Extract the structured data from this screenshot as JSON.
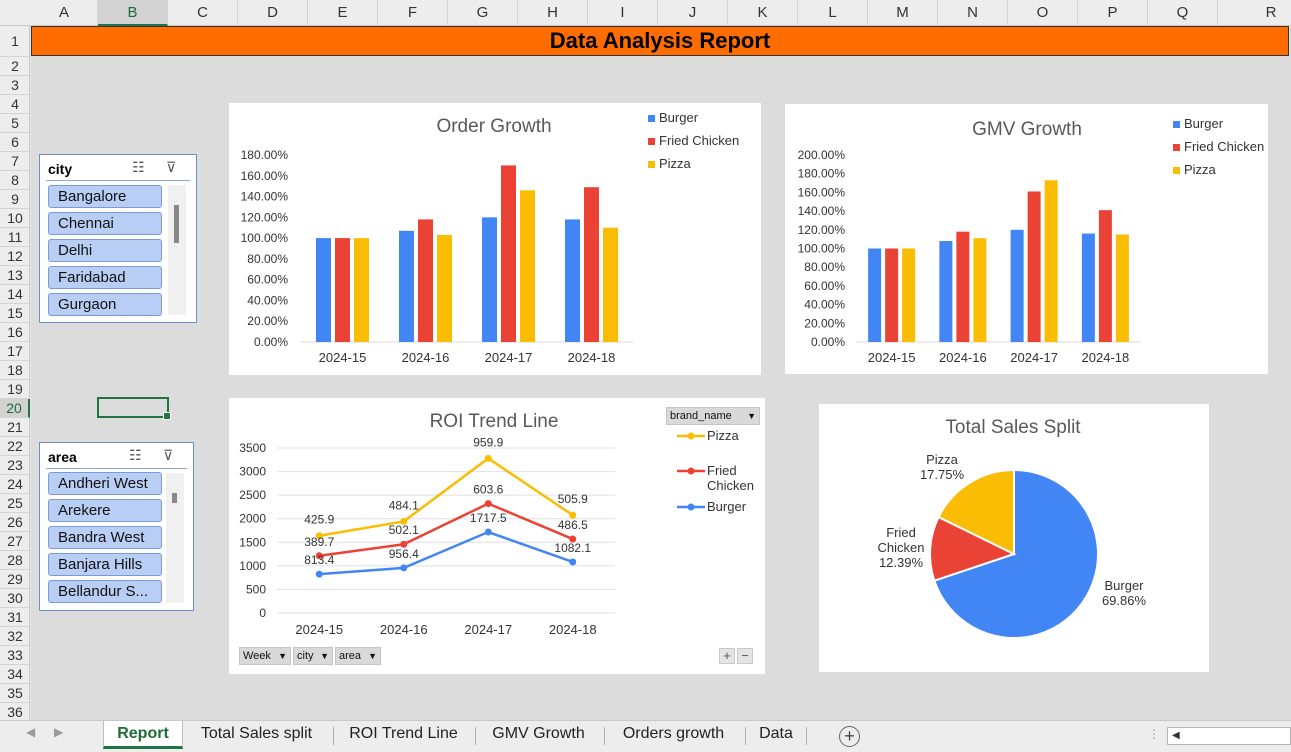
{
  "columns": [
    "A",
    "B",
    "C",
    "D",
    "E",
    "F",
    "G",
    "H",
    "I",
    "J",
    "K",
    "L",
    "M",
    "N",
    "O",
    "P",
    "Q",
    "R"
  ],
  "rows": [
    "1",
    "2",
    "3",
    "4",
    "5",
    "6",
    "7",
    "8",
    "9",
    "10",
    "11",
    "12",
    "13",
    "14",
    "15",
    "16",
    "17",
    "18",
    "19",
    "20",
    "21",
    "22",
    "23",
    "24",
    "25",
    "26",
    "27",
    "28",
    "29",
    "30",
    "31",
    "32",
    "33",
    "34",
    "35",
    "36"
  ],
  "selected_column": "B",
  "selected_row": "20",
  "title": "Data Analysis Report",
  "colors": {
    "burger": "#4285f4",
    "fried_chicken": "#ea4335",
    "pizza": "#fbbc04",
    "title_bg": "#ff6d00",
    "accent": "#217346"
  },
  "slicers": {
    "city": {
      "title": "city",
      "items": [
        "Bangalore",
        "Chennai",
        "Delhi",
        "Faridabad",
        "Gurgaon"
      ],
      "icons": [
        "multi-select-icon",
        "clear-filter-icon"
      ]
    },
    "area": {
      "title": "area",
      "items": [
        "Andheri West",
        "Arekere",
        "Bandra West",
        "Banjara Hills",
        "Bellandur S..."
      ],
      "icons": [
        "multi-select-icon",
        "clear-filter-icon"
      ]
    }
  },
  "pivot": {
    "legend_field": "brand_name",
    "filters": [
      "Week",
      "city",
      "area"
    ],
    "zoom_in": "+",
    "zoom_out": "−"
  },
  "tabs": {
    "items": [
      "Report",
      "Total Sales split",
      "ROI Trend Line",
      "GMV Growth",
      "Orders growth",
      "Data"
    ],
    "active": "Report"
  },
  "chart_data": [
    {
      "type": "bar",
      "title": "Order Growth",
      "categories": [
        "2024-15",
        "2024-16",
        "2024-17",
        "2024-18"
      ],
      "series": [
        {
          "name": "Burger",
          "values": [
            100,
            107,
            120,
            118
          ]
        },
        {
          "name": "Fried Chicken",
          "values": [
            100,
            118,
            170,
            149
          ]
        },
        {
          "name": "Pizza",
          "values": [
            100,
            103,
            146,
            110
          ]
        }
      ],
      "ylim": [
        0,
        180
      ],
      "yticks": [
        "0.00%",
        "20.00%",
        "40.00%",
        "60.00%",
        "80.00%",
        "100.00%",
        "120.00%",
        "140.00%",
        "160.00%",
        "180.00%"
      ],
      "legend": "top-right",
      "grid": false
    },
    {
      "type": "bar",
      "title": "GMV Growth",
      "categories": [
        "2024-15",
        "2024-16",
        "2024-17",
        "2024-18"
      ],
      "series": [
        {
          "name": "Burger",
          "values": [
            100,
            108,
            120,
            116
          ]
        },
        {
          "name": "Fried Chicken",
          "values": [
            100,
            118,
            161,
            141
          ]
        },
        {
          "name": "Pizza",
          "values": [
            100,
            111,
            173,
            115
          ]
        }
      ],
      "ylim": [
        0,
        200
      ],
      "yticks": [
        "0.00%",
        "20.00%",
        "40.00%",
        "60.00%",
        "80.00%",
        "100.00%",
        "120.00%",
        "140.00%",
        "160.00%",
        "180.00%",
        "200.00%"
      ],
      "legend": "top-right",
      "grid": false
    },
    {
      "type": "line",
      "title": "ROI Trend Line",
      "x": [
        "2024-15",
        "2024-16",
        "2024-17",
        "2024-18"
      ],
      "series": [
        {
          "name": "Pizza",
          "values": [
            1639.4,
            1942.6,
            3281,
            2074.5
          ],
          "labels": [
            "425.9",
            "484.1",
            "959.9",
            "505.9"
          ]
        },
        {
          "name": "Fried Chicken",
          "values": [
            1213.5,
            1458.5,
            2321.1,
            1568.6
          ],
          "labels": [
            "389.7",
            "502.1",
            "603.6",
            "486.5"
          ]
        },
        {
          "name": "Burger",
          "values": [
            823.8,
            956.4,
            1717.5,
            1082.1
          ],
          "labels": [
            "813.4",
            "956.4",
            "1717.5",
            "1082.1"
          ]
        }
      ],
      "ylim": [
        0,
        3500
      ],
      "yticks": [
        "0",
        "500",
        "1000",
        "1500",
        "2000",
        "2500",
        "3000",
        "3500"
      ],
      "legend": "right",
      "grid": true
    },
    {
      "type": "pie",
      "title": "Total Sales Split",
      "slices": [
        {
          "name": "Burger",
          "value": 69.86,
          "label": "69.86%"
        },
        {
          "name": "Fried Chicken",
          "value": 12.39,
          "label": "12.39%"
        },
        {
          "name": "Pizza",
          "value": 17.75,
          "label": "17.75%"
        }
      ]
    }
  ]
}
